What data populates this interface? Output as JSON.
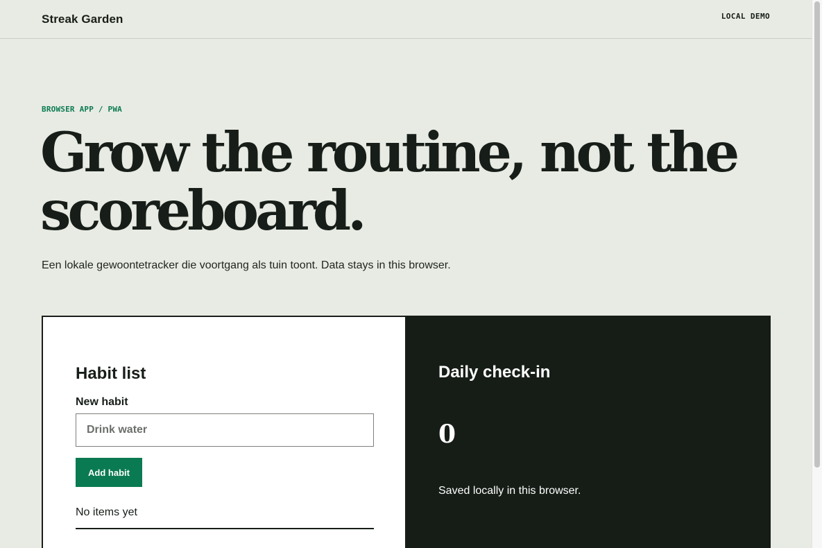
{
  "header": {
    "brand": "Streak Garden",
    "badge": "LOCAL DEMO"
  },
  "hero": {
    "eyebrow": "BROWSER APP / PWA",
    "headline": "Grow the routine, not the scoreboard.",
    "lead": "Een lokale gewoontetracker die voortgang als tuin toont. Data stays in this browser."
  },
  "habits": {
    "title": "Habit list",
    "input_label": "New habit",
    "input_placeholder": "Drink water",
    "input_value": "",
    "add_button_label": "Add habit",
    "empty_text": "No items yet"
  },
  "checkin": {
    "title": "Daily check-in",
    "count": "0",
    "saved_note": "Saved locally in this browser."
  },
  "colors": {
    "background": "#e8ebe3",
    "ink": "#171d18",
    "accent": "#0a7a52",
    "dark_panel": "#161d17"
  }
}
